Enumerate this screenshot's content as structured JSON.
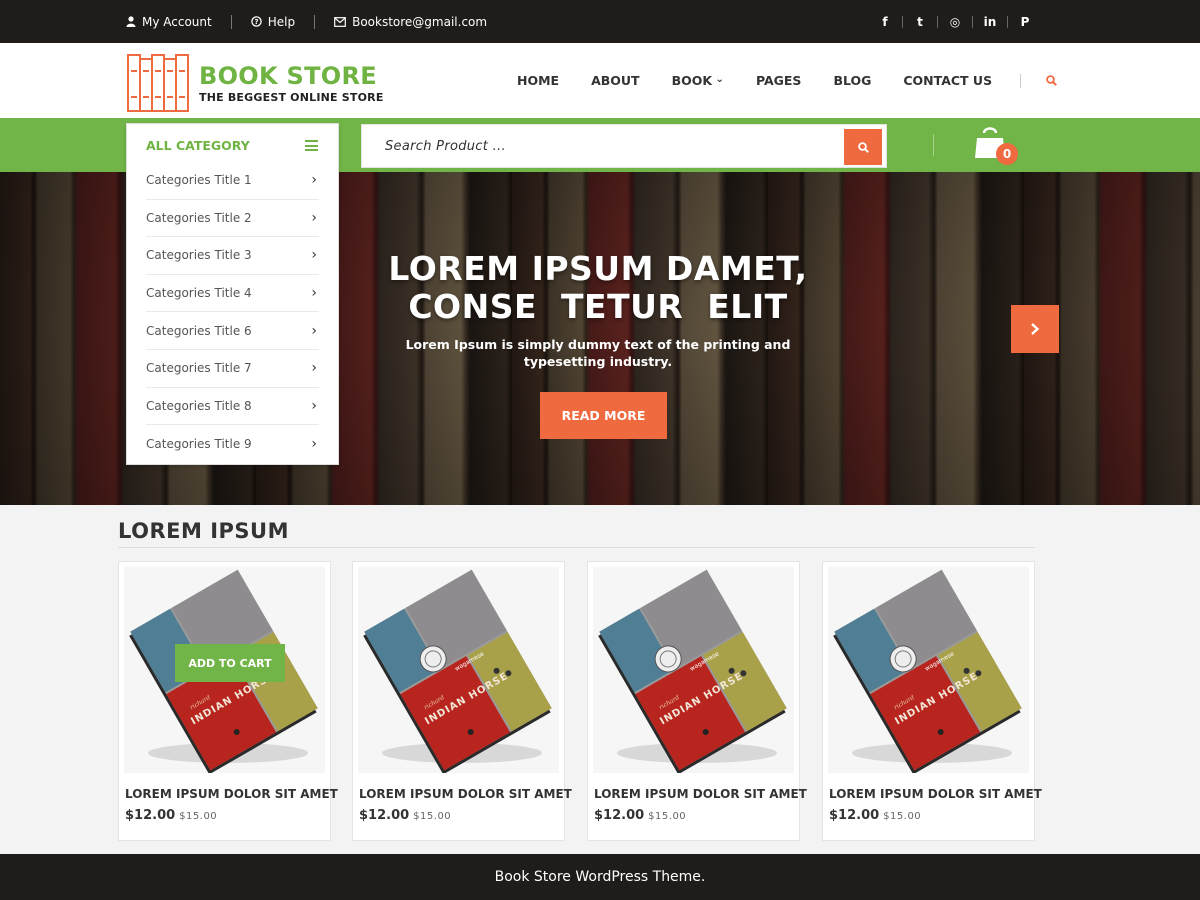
{
  "topbar": {
    "account": "My Account",
    "help": "Help",
    "email": "Bookstore@gmail.com",
    "social": [
      {
        "icon": "facebook-icon",
        "glyph": "f"
      },
      {
        "icon": "twitter-icon",
        "glyph": "t"
      },
      {
        "icon": "instagram-icon",
        "glyph": "◎"
      },
      {
        "icon": "linkedin-icon",
        "glyph": "in"
      },
      {
        "icon": "pinterest-icon",
        "glyph": "P"
      }
    ]
  },
  "header": {
    "brand": "BOOK STORE",
    "tagline": "THE BEGGEST ONLINE STORE",
    "nav": [
      "HOME",
      "ABOUT",
      "BOOK",
      "PAGES",
      "BLOG",
      "CONTACT US"
    ]
  },
  "colors": {
    "green": "#71b548",
    "orange": "#f06a40",
    "dark": "#1f1c1a"
  },
  "category": {
    "title": "ALL CATEGORY",
    "items": [
      "Categories Title 1",
      "Categories Title 2",
      "Categories Title 3",
      "Categories Title 4",
      "Categories Title 6",
      "Categories Title 7",
      "Categories Title 8",
      "Categories Title 9"
    ]
  },
  "search": {
    "placeholder": "Search Product ..."
  },
  "cart": {
    "count": "0"
  },
  "hero": {
    "title_line1": "LOREM IPSUM DAMET,",
    "title_line2": "CONSE  TETUR  ELIT",
    "text": "Lorem Ipsum is simply dummy text of the printing and typesetting industry.",
    "button": "READ MORE"
  },
  "products": {
    "section_title": "LOREM IPSUM",
    "add_to_cart": "ADD TO CART",
    "items": [
      {
        "name": "LOREM IPSUM DOLOR SIT AMET",
        "price": "$12.00",
        "old_price": "$15.00"
      },
      {
        "name": "LOREM IPSUM DOLOR SIT AMET",
        "price": "$12.00",
        "old_price": "$15.00"
      },
      {
        "name": "LOREM IPSUM DOLOR SIT AMET",
        "price": "$12.00",
        "old_price": "$15.00"
      },
      {
        "name": "LOREM IPSUM DOLOR SIT AMET",
        "price": "$12.00",
        "old_price": "$15.00"
      }
    ],
    "book_cover": {
      "author": "richard",
      "author2": "wagamese",
      "title": "INDIAN HORSE"
    }
  },
  "footer": {
    "text": "Book Store WordPress Theme."
  }
}
